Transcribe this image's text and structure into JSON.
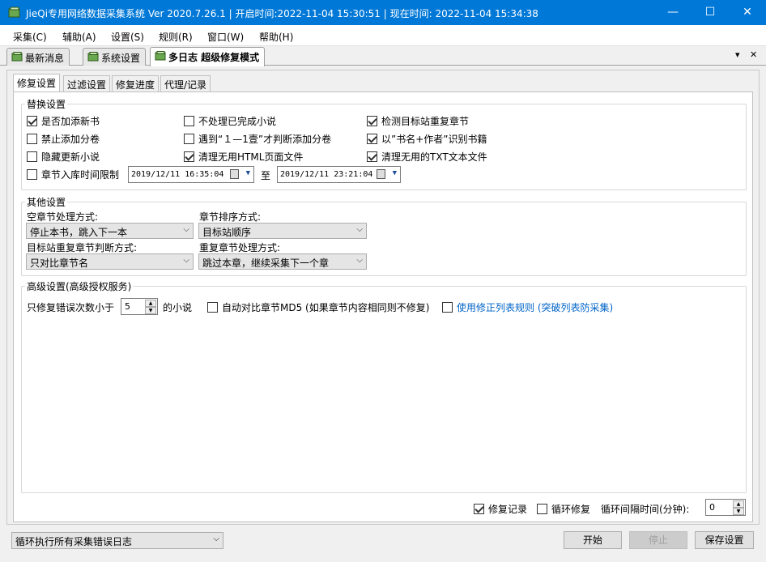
{
  "window": {
    "title": "JieQi专用网络数据采集系统 Ver 2020.7.26.1 | 开启时间:2022-11-04 15:30:51 | 现在时间: 2022-11-04 15:34:38",
    "minimize": "—",
    "maximize": "☐",
    "close": "✕"
  },
  "menu": {
    "items": [
      "采集(C)",
      "辅助(A)",
      "设置(S)",
      "规则(R)",
      "窗口(W)",
      "帮助(H)"
    ]
  },
  "doc_tabs": {
    "items": [
      "最新消息",
      "系统设置",
      "多日志 超级修复模式"
    ],
    "active": 2,
    "dropdown_glyph": "▾",
    "close_glyph": "✕"
  },
  "inner_tabs": {
    "items": [
      "修复设置",
      "过滤设置",
      "修复进度",
      "代理/记录"
    ],
    "active": 0
  },
  "replace_group": {
    "legend": "替换设置",
    "checkboxes": [
      {
        "label": "是否加添新书",
        "checked": true
      },
      {
        "label": "不处理已完成小说",
        "checked": false
      },
      {
        "label": "检测目标站重复章节",
        "checked": true
      },
      {
        "label": "禁止添加分卷",
        "checked": false
      },
      {
        "label": "遇到“１—1壹”才判断添加分卷",
        "checked": false
      },
      {
        "label": "以”书名+作者”识别书籍",
        "checked": true
      },
      {
        "label": "隐藏更新小说",
        "checked": false
      },
      {
        "label": "清理无用HTML页面文件",
        "checked": true
      },
      {
        "label": "清理无用的TXT文本文件",
        "checked": true
      },
      {
        "label": "章节入库时间限制",
        "checked": false
      }
    ],
    "date_from": "2019/12/11 16:35:04",
    "to_label": "至",
    "date_to": "2019/12/11 23:21:04"
  },
  "other_group": {
    "legend": "其他设置",
    "empty_chapter_label": "空章节处理方式:",
    "empty_chapter_value": "停止本书，跳入下一本",
    "sort_label": "章节排序方式:",
    "sort_value": "目标站顺序",
    "dup_judge_label": "目标站重复章节判断方式:",
    "dup_judge_value": "只对比章节名",
    "dup_handle_label": "重复章节处理方式:",
    "dup_handle_value": "跳过本章，继续采集下一个章"
  },
  "advanced_group": {
    "legend": "高级设置(高级授权服务)",
    "error_prefix": "只修复错误次数小于",
    "error_value": "5",
    "error_suffix": "的小说",
    "md5_label": "自动对比章节MD5 (如果章节内容相同则不修复)",
    "md5_checked": false,
    "fix_rules_label": "使用修正列表规则 (突破列表防采集)",
    "fix_rules_checked": false
  },
  "footer_row": {
    "repair_log_label": "修复记录",
    "repair_log_checked": true,
    "loop_repair_label": "循环修复",
    "loop_repair_checked": false,
    "interval_label": "循环间隔时间(分钟):",
    "interval_value": "0"
  },
  "bottom": {
    "mode_value": "循环执行所有采集错误日志",
    "start": "开始",
    "stop": "停止",
    "save": "保存设置"
  },
  "colors": {
    "titlebar": "#0078d7",
    "link": "#0064c8"
  }
}
